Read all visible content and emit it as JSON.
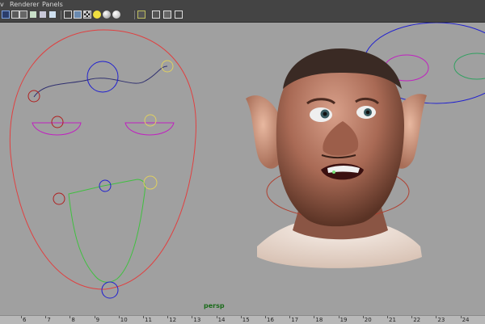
{
  "menu": {
    "items": [
      {
        "label": "v",
        "x_hint": 0
      },
      {
        "label": "Renderer"
      },
      {
        "label": "Panels"
      }
    ]
  },
  "toolbar": {
    "icons": [
      "camera-icon",
      "grid-icon",
      "wireframe-icon",
      "film-icon",
      "texture-icon",
      "cube-wire-icon",
      "cube-shaded-icon",
      "checker-icon",
      "light-icon",
      "sphere-icon",
      "sphere-lit-icon",
      "select-icon",
      "isolate-icon",
      "xray-icon",
      "joints-icon"
    ]
  },
  "viewport": {
    "camera_label": "persp"
  },
  "timeline": {
    "ticks": [
      "6",
      "7",
      "8",
      "9",
      "10",
      "11",
      "12",
      "13",
      "14",
      "15",
      "16",
      "17",
      "18",
      "19",
      "20",
      "21",
      "22",
      "23",
      "24"
    ]
  },
  "colors": {
    "menubar_bg": "#444444",
    "viewport_bg": "#a0a0a0",
    "head_outline": "#e04040",
    "brow_curve": "#303070",
    "circle_blue": "#2020d0",
    "circle_red": "#b02020",
    "circle_yellow": "#e0d060",
    "eye_magenta": "#c020c0",
    "mouth_green": "#40c040",
    "camera_label": "#1a6b1a"
  }
}
